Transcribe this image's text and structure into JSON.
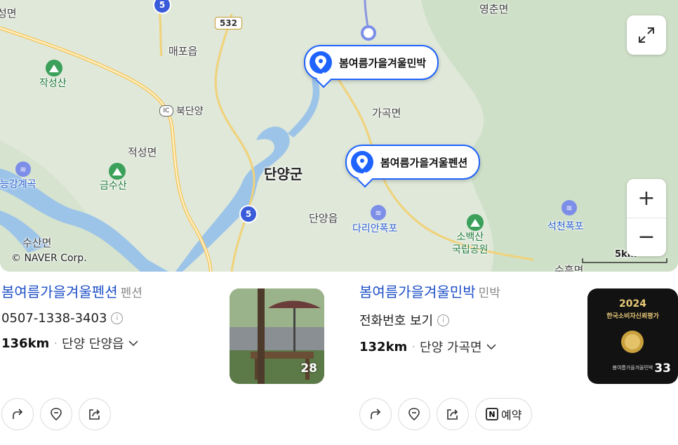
{
  "map": {
    "labels": {
      "yeongchun": "영춘면",
      "maepo": "매포읍",
      "jakseongsan": "작성산",
      "bukdanyang": "북단양",
      "jeokseong": "적성면",
      "neunggang": "능강계곡",
      "geumsusan": "금수산",
      "susan": "수산면",
      "gagok": "가곡면",
      "danyanggun": "단양군",
      "danyangeup": "단양읍",
      "darian": "다리안폭포",
      "sobaek": "소백산\n국립공원",
      "seokcheon": "석천폭포",
      "sucheol": "수흥면",
      "topleft": "성면",
      "ic": "IC"
    },
    "road_shields": {
      "r532": "532",
      "r5a": "5",
      "r5b": "5"
    },
    "pins": [
      {
        "label": "봄여름가을겨울민박"
      },
      {
        "label": "봄여름가을겨울펜션"
      }
    ],
    "copyright": "© NAVER Corp.",
    "scale": "5km",
    "controls": {
      "expand_icon": "expand-icon",
      "zoom_in": "+",
      "zoom_out": "−"
    }
  },
  "results": [
    {
      "name": "봄여름가을겨울펜션",
      "category": "펜션",
      "phone": "0507-1338-3403",
      "distance": "136km",
      "address": "단양 단양읍",
      "photo_count": "28"
    },
    {
      "name": "봄여름가을겨울민박",
      "category": "민박",
      "phone": "전화번호 보기",
      "distance": "132km",
      "address": "단양 가곡면",
      "photo_count": "33",
      "reserve_label": "예약",
      "thumb_year": "2024",
      "thumb_title": "한국소비자신뢰평가",
      "thumb_caption": "봄여름가을겨울민박"
    }
  ],
  "colors": {
    "accent": "#1f63ff",
    "link": "#1e4fc7",
    "park": "#3aa05a"
  }
}
